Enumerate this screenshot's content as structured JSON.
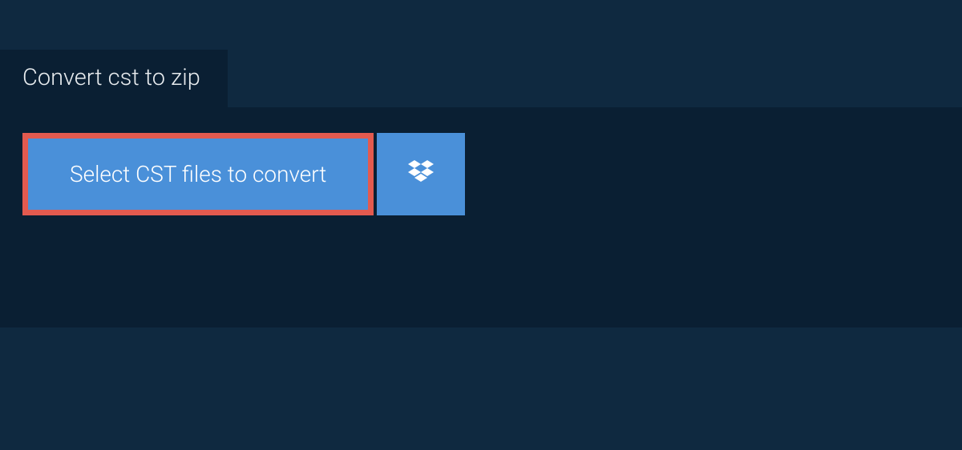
{
  "tab": {
    "title": "Convert cst to zip"
  },
  "buttons": {
    "select_label": "Select CST files to convert"
  },
  "colors": {
    "background": "#0f2940",
    "panel": "#0a1f33",
    "button": "#4a90d9",
    "highlight_border": "#e35a4f",
    "text": "#ffffff"
  }
}
